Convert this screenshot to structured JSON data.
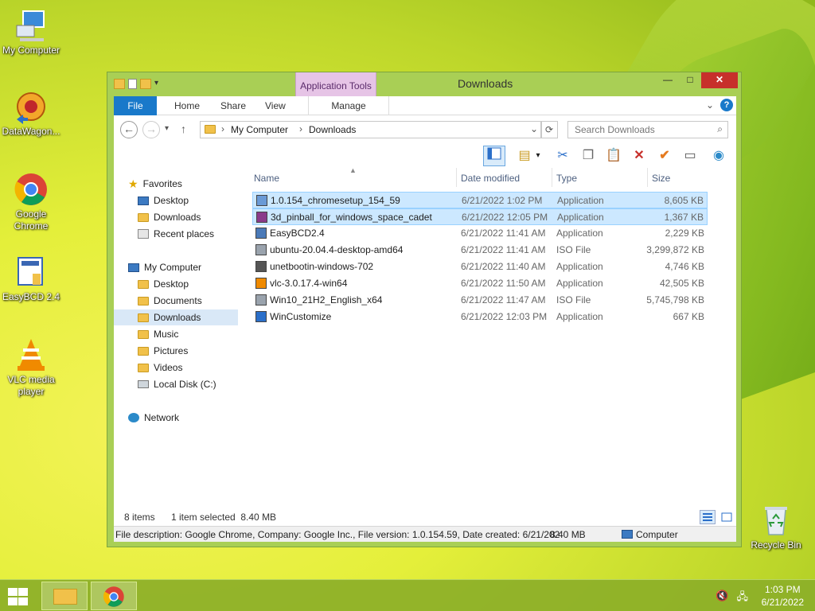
{
  "desktop": {
    "icons": [
      {
        "label": "My Computer"
      },
      {
        "label": "DataWagon..."
      },
      {
        "label": "Google Chrome"
      },
      {
        "label": "EasyBCD 2.4"
      },
      {
        "label": "VLC media player"
      },
      {
        "label": "Recycle Bin"
      }
    ]
  },
  "window": {
    "title": "Downloads",
    "contextual_tab": "Application Tools",
    "ribbon_tabs": [
      "File",
      "Home",
      "Share",
      "View",
      "Manage"
    ],
    "min_label": "—",
    "max_label": "□",
    "close_label": "✕"
  },
  "address": {
    "crumbs": [
      "My Computer",
      "Downloads"
    ],
    "search_placeholder": "Search Downloads"
  },
  "nav": {
    "favorites": {
      "label": "Favorites",
      "items": [
        "Desktop",
        "Downloads",
        "Recent places"
      ]
    },
    "computer": {
      "label": "My Computer",
      "items": [
        "Desktop",
        "Documents",
        "Downloads",
        "Music",
        "Pictures",
        "Videos",
        "Local Disk (C:)"
      ]
    },
    "network": {
      "label": "Network"
    }
  },
  "columns": {
    "name": "Name",
    "date": "Date modified",
    "type": "Type",
    "size": "Size"
  },
  "files": [
    {
      "name": "1.0.154_chromesetup_154_59",
      "date": "6/21/2022 1:02 PM",
      "type": "Application",
      "size": "8,605 KB",
      "icon": "chrome-setup-icon",
      "selected": true
    },
    {
      "name": "3d_pinball_for_windows_space_cadet",
      "date": "6/21/2022 12:05 PM",
      "type": "Application",
      "size": "1,367 KB",
      "icon": "archive-icon",
      "selected": true
    },
    {
      "name": "EasyBCD2.4",
      "date": "6/21/2022 11:41 AM",
      "type": "Application",
      "size": "2,229 KB",
      "icon": "setup-icon",
      "selected": false
    },
    {
      "name": "ubuntu-20.04.4-desktop-amd64",
      "date": "6/21/2022 11:41 AM",
      "type": "ISO File",
      "size": "3,299,872 KB",
      "icon": "iso-icon",
      "selected": false
    },
    {
      "name": "unetbootin-windows-702",
      "date": "6/21/2022 11:40 AM",
      "type": "Application",
      "size": "4,746 KB",
      "icon": "unetbootin-icon",
      "selected": false
    },
    {
      "name": "vlc-3.0.17.4-win64",
      "date": "6/21/2022 11:50 AM",
      "type": "Application",
      "size": "42,505 KB",
      "icon": "vlc-icon",
      "selected": false
    },
    {
      "name": "Win10_21H2_English_x64",
      "date": "6/21/2022 11:47 AM",
      "type": "ISO File",
      "size": "5,745,798 KB",
      "icon": "iso-icon",
      "selected": false
    },
    {
      "name": "WinCustomize",
      "date": "6/21/2022 12:03 PM",
      "type": "Application",
      "size": "667 KB",
      "icon": "wincustomize-icon",
      "selected": false
    }
  ],
  "status": {
    "items": "8 items",
    "selected": "1 item selected  8.40 MB"
  },
  "details": {
    "description": "File description: Google Chrome, Company: Google Inc., File version: 1.0.154.59, Date created: 6/21/202",
    "size": "8.40 MB",
    "location": "Computer"
  },
  "taskbar": {
    "time": "1:03 PM",
    "date": "6/21/2022"
  },
  "colors": {
    "accent": "#1979ca",
    "close": "#c7302b",
    "selection": "#cce8ff"
  }
}
